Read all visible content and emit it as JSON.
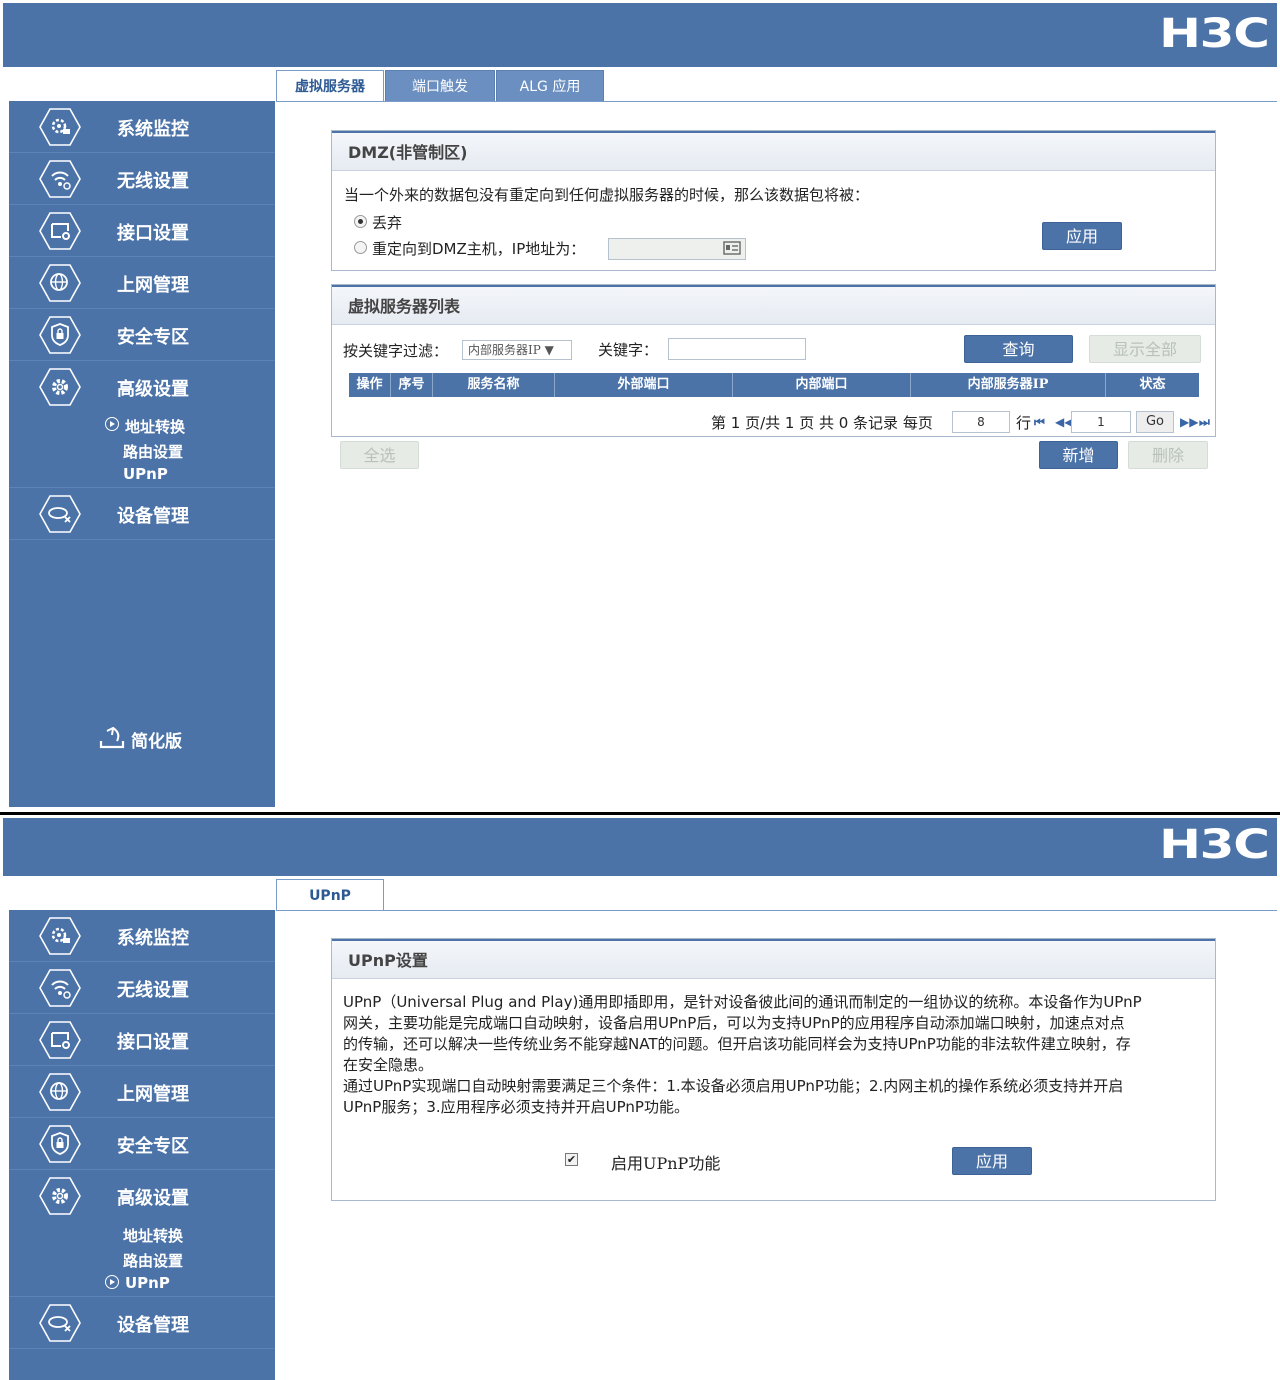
{
  "brand": {
    "logo": "H3C"
  },
  "sidebar": {
    "items": [
      {
        "label": "系统监控",
        "icon": "monitor-gear-icon"
      },
      {
        "label": "无线设置",
        "icon": "wifi-icon"
      },
      {
        "label": "接口设置",
        "icon": "interface-icon"
      },
      {
        "label": "上网管理",
        "icon": "globe-icon"
      },
      {
        "label": "安全专区",
        "icon": "shield-lock-icon"
      },
      {
        "label": "高级设置",
        "icon": "gear-icon"
      },
      {
        "label": "设备管理",
        "icon": "device-icon"
      }
    ],
    "sub_items": [
      "地址转换",
      "路由设置",
      "UPnP"
    ],
    "simple_mode": "简化版"
  },
  "screen1": {
    "tabs": [
      "虚拟服务器",
      "端口触发",
      "ALG 应用"
    ],
    "dmz": {
      "title": "DMZ(非管制区)",
      "desc": "当一个外来的数据包没有重定向到任何虚拟服务器的时候，那么该数据包将被：",
      "option_discard": "丢弃",
      "option_redirect": "重定向到DMZ主机，IP地址为：",
      "apply": "应用"
    },
    "vs": {
      "title": "虚拟服务器列表",
      "filter_label": "按关键字过滤：",
      "filter_select": "内部服务器IP ▼",
      "keyword_label": "关键字：",
      "keyword_value": "",
      "search": "查询",
      "show_all": "显示全部",
      "columns": [
        "操作",
        "序号",
        "服务名称",
        "外部端口",
        "内部端口",
        "内部服务器IP",
        "状态"
      ],
      "pager": {
        "summary": "第 1 页/共 1 页 共 0 条记录 每页",
        "per_page": "8",
        "rows_label": "行",
        "page": "1",
        "go": "Go"
      },
      "select_all": "全选",
      "add": "新增",
      "delete": "删除"
    }
  },
  "screen2": {
    "tabs": [
      "UPnP"
    ],
    "upnp": {
      "title": "UPnP设置",
      "lines": [
        "UPnP（Universal Plug and Play)通用即插即用，是针对设备彼此间的通讯而制定的一组协议的统称。本设备作为UPnP",
        "网关，主要功能是完成端口自动映射，设备启用UPnP后，可以为支持UPnP的应用程序自动添加端口映射，加速点对点",
        "的传输，还可以解决一些传统业务不能穿越NAT的问题。但开启该功能同样会为支持UPnP功能的非法软件建立映射，存",
        "在安全隐患。",
        "通过UPnP实现端口自动映射需要满足三个条件：1.本设备必须启用UPnP功能；2.内网主机的操作系统必须支持并开启",
        "UPnP服务；3.应用程序必须支持并开启UPnP功能。"
      ],
      "enable_label": "启用UPnP功能",
      "enabled": true,
      "apply": "应用"
    }
  }
}
